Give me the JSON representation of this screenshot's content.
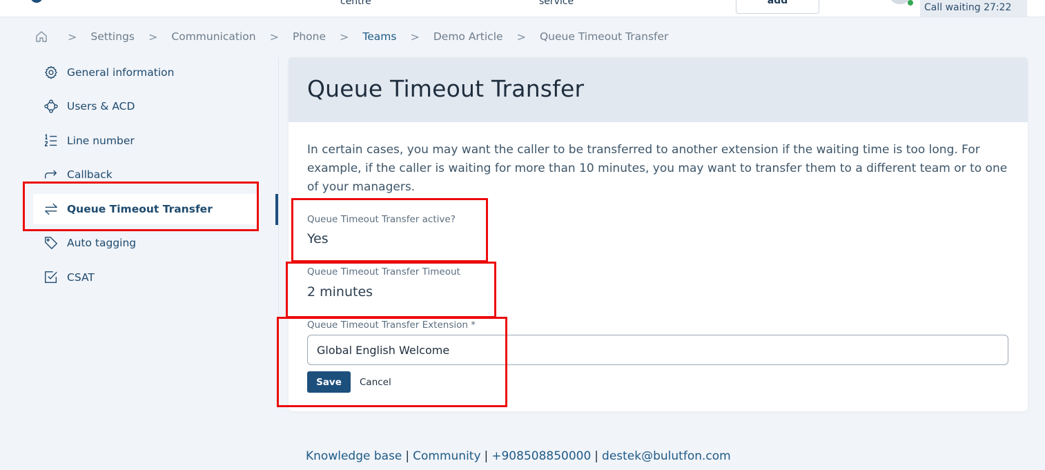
{
  "header": {
    "nav_item_1": "centre",
    "nav_item_2": "service",
    "add_button": "add",
    "call_waiting": "Call waiting 27:22"
  },
  "breadcrumb": {
    "home_icon": "home-icon",
    "items": [
      "Settings",
      "Communication",
      "Phone",
      "Teams",
      "Demo Article",
      "Queue Timeout Transfer"
    ],
    "separator": ">"
  },
  "sidebar": {
    "items": [
      {
        "label": "General information",
        "icon": "gear-icon"
      },
      {
        "label": "Users & ACD",
        "icon": "users-icon"
      },
      {
        "label": "Line number",
        "icon": "numbered-list-icon"
      },
      {
        "label": "Callback",
        "icon": "callback-arrow-icon"
      },
      {
        "label": "Queue Timeout Transfer",
        "icon": "transfer-arrows-icon",
        "active": true
      },
      {
        "label": "Auto tagging",
        "icon": "tag-icon"
      },
      {
        "label": "CSAT",
        "icon": "checkbox-icon"
      }
    ]
  },
  "main": {
    "title": "Queue Timeout Transfer",
    "description": "In certain cases, you may want the caller to be transferred to another extension if the waiting time is too long. For example, if the caller is waiting for more than 10 minutes, you may want to transfer them to a different team or to one of your managers.",
    "active_label": "Queue Timeout Transfer active?",
    "active_value": "Yes",
    "timeout_label": "Queue Timeout Transfer Timeout",
    "timeout_value": "2 minutes",
    "extension_label": "Queue Timeout Transfer Extension *",
    "extension_value": "Global English Welcome",
    "save_label": "Save",
    "cancel_label": "Cancel"
  },
  "footer": {
    "links": [
      "Knowledge base",
      "Community",
      "+908508850000",
      "destek@bulutfon.com"
    ],
    "separator": "|"
  },
  "colors": {
    "brand": "#1d4f7c",
    "highlight_box": "#ec0b0b",
    "card_header": "#e2e8f0",
    "page_background": "#f1f4f9"
  }
}
